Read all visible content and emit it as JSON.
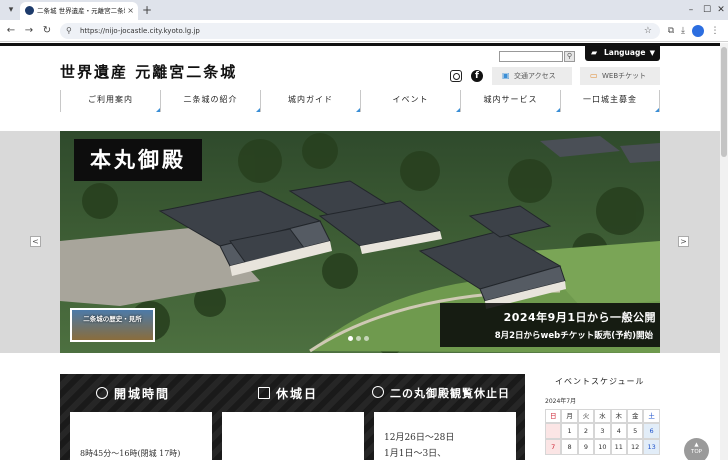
{
  "browser": {
    "tab_title": "二条城 世界遺産・元離宮二条城",
    "tab_close": "×",
    "new_tab": "+",
    "url": "https://nijo-jocastle.city.kyoto.lg.jp",
    "minimize": "–",
    "maximize": "☐",
    "close": "✕",
    "back": "←",
    "forward": "→",
    "reload": "↻",
    "site_info": "⚲",
    "bookmark": "☆",
    "extensions": "⧉",
    "download": "⤓",
    "menu": "⋮"
  },
  "header": {
    "logo": "世界遺産 元離宮二条城",
    "search_placeholder": "",
    "language_label": "Language",
    "access_label": "交通アクセス",
    "ticket_label": "WEBチケット",
    "facebook_glyph": "f"
  },
  "nav": [
    {
      "label": "ご利用案内"
    },
    {
      "label": "二条城の紹介"
    },
    {
      "label": "城内ガイド"
    },
    {
      "label": "イベント"
    },
    {
      "label": "城内サービス"
    },
    {
      "label": "一口城主募金"
    }
  ],
  "hero": {
    "badge": "本丸御殿",
    "history_link": "二条城の歴史・見所",
    "announce_line1": "2024年9月1日から一般公開",
    "announce_line2": "8月2日からwebチケット販売(予約)開始",
    "prev": "<",
    "next": ">"
  },
  "info": {
    "hours_title": "開城時間",
    "closed_title": "休城日",
    "ninomaru_title": "二の丸御殿観覧休止日",
    "hours_text": "8時45分～16時(閉城 17時)",
    "ninomaru_text1": "12月26日～28日",
    "ninomaru_text2": "1月1日～3日、"
  },
  "events": {
    "title": "イベントスケジュール",
    "month": "2024年7月",
    "weekdays": [
      "日",
      "月",
      "火",
      "水",
      "木",
      "金",
      "土"
    ],
    "weeks": [
      [
        "",
        "1",
        "2",
        "3",
        "4",
        "5",
        "6"
      ],
      [
        "7",
        "8",
        "9",
        "10",
        "11",
        "12",
        "13"
      ]
    ]
  },
  "top_button": "TOP"
}
